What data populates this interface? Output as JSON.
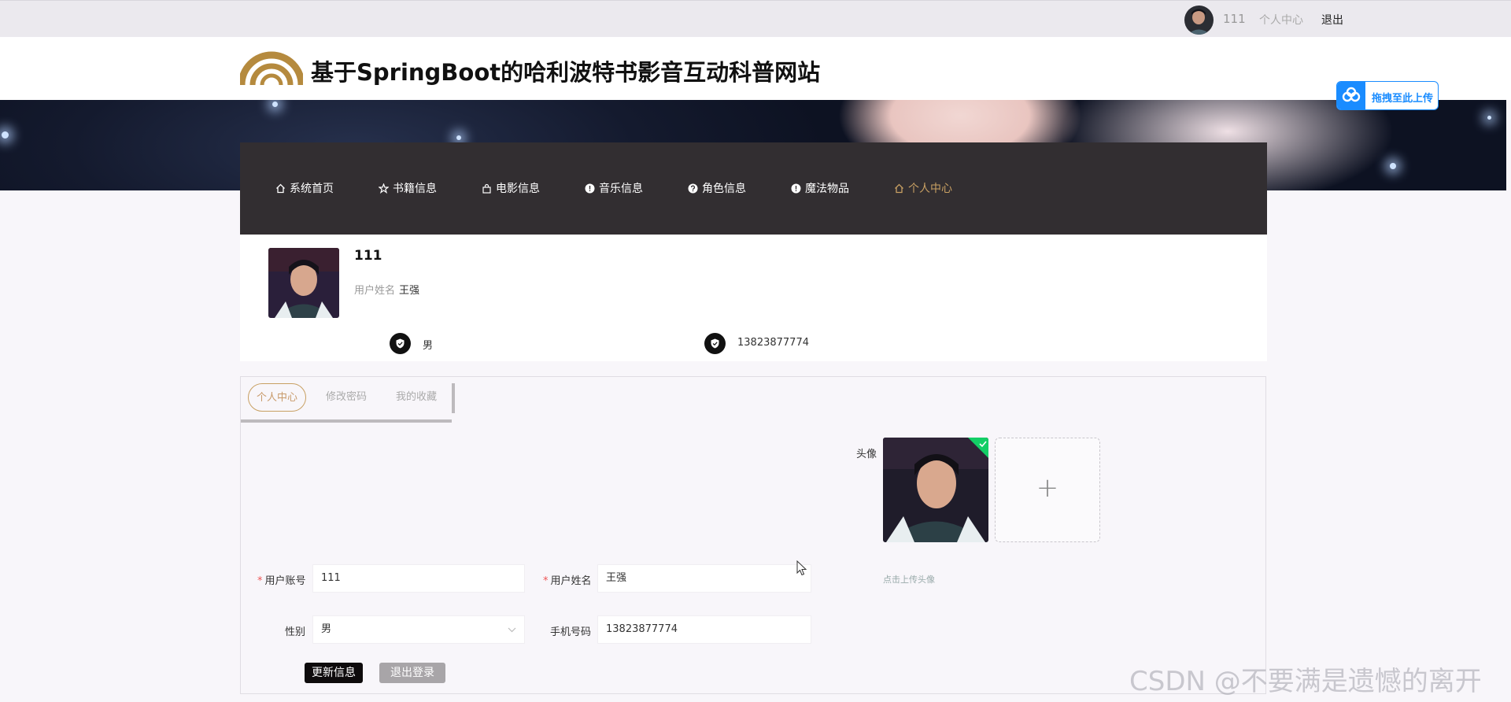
{
  "topbar": {
    "username": "111",
    "center_link": "个人中心",
    "logout": "退出"
  },
  "header": {
    "title": "基于SpringBoot的哈利波特书影音互动科普网站",
    "upload_chip": "拖拽至此上传"
  },
  "nav": {
    "items": [
      {
        "label": "系统首页",
        "icon": "home-icon"
      },
      {
        "label": "书籍信息",
        "icon": "star-icon"
      },
      {
        "label": "电影信息",
        "icon": "bag-icon"
      },
      {
        "label": "音乐信息",
        "icon": "info-icon"
      },
      {
        "label": "角色信息",
        "icon": "question-icon"
      },
      {
        "label": "魔法物品",
        "icon": "info-icon"
      },
      {
        "label": "个人中心",
        "icon": "home-icon",
        "active": true
      }
    ]
  },
  "profile": {
    "name": "111",
    "username_label": "用户姓名",
    "username_value": "王强",
    "gender": "男",
    "phone": "13823877774"
  },
  "tabs": [
    {
      "label": "个人中心",
      "active": true
    },
    {
      "label": "修改密码"
    },
    {
      "label": "我的收藏"
    }
  ],
  "form": {
    "account_label": "用户账号",
    "account_value": "111",
    "name_label": "用户姓名",
    "name_value": "王强",
    "gender_label": "性别",
    "gender_value": "男",
    "phone_label": "手机号码",
    "phone_value": "13823877774",
    "avatar_label": "头像",
    "upload_tip": "点击上传头像",
    "add_symbol": "+",
    "update_button": "更新信息",
    "logout_button": "退出登录"
  },
  "watermark": "CSDN @不要满是遗憾的离开",
  "colors": {
    "nav_bg": "#322e31",
    "accent": "#c8a063",
    "chip_blue": "#1a8cff",
    "success": "#13ce66"
  }
}
